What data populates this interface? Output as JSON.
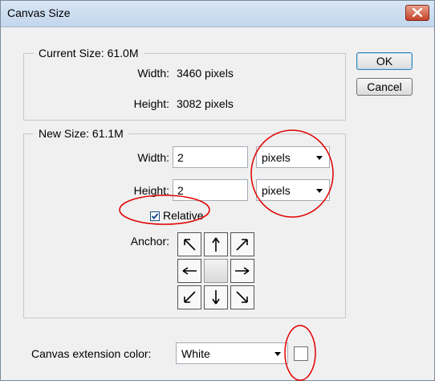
{
  "window": {
    "title": "Canvas Size"
  },
  "buttons": {
    "ok": "OK",
    "cancel": "Cancel"
  },
  "current_size": {
    "legend": "Current Size: 61.0M",
    "width_label": "Width:",
    "width_value": "3460 pixels",
    "height_label": "Height:",
    "height_value": "3082 pixels"
  },
  "new_size": {
    "legend": "New Size: 61.1M",
    "width_label": "Width:",
    "width_value": "2",
    "width_unit": "pixels",
    "height_label": "Height:",
    "height_value": "2",
    "height_unit": "pixels",
    "relative_label": "Relative",
    "relative_checked": true,
    "anchor_label": "Anchor:"
  },
  "canvas_extension": {
    "label": "Canvas extension color:",
    "value": "White",
    "swatch_color": "#ffffff"
  },
  "annotation_color": "#e00000",
  "icons": [
    "close-icon",
    "checkmark-icon",
    "arrow-nw-icon",
    "arrow-up-icon",
    "arrow-ne-icon",
    "arrow-left-icon",
    "arrow-right-icon",
    "arrow-sw-icon",
    "arrow-down-icon",
    "arrow-se-icon",
    "chevron-down-icon"
  ]
}
